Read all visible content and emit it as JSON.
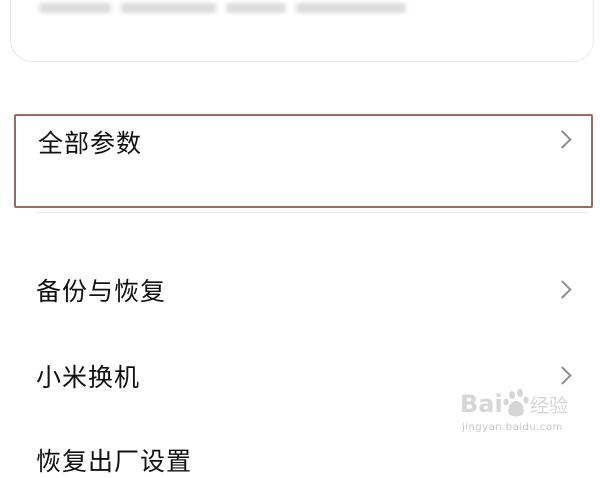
{
  "top_card": {
    "blurred": true
  },
  "settings": [
    {
      "label": "全部参数",
      "highlighted": true
    },
    {
      "label": "备份与恢复"
    },
    {
      "label": "小米换机"
    },
    {
      "label": "恢复出厂设置"
    }
  ],
  "icons": {
    "chevron": "chevron-right-icon"
  },
  "colors": {
    "highlight_border": "#9a6a5a",
    "text": "#111111",
    "chevron": "#8e8e8e",
    "divider": "#eeeeee"
  },
  "watermark": {
    "logo_text": "Baidu经验",
    "domain": "jingyan.baidu.com"
  }
}
